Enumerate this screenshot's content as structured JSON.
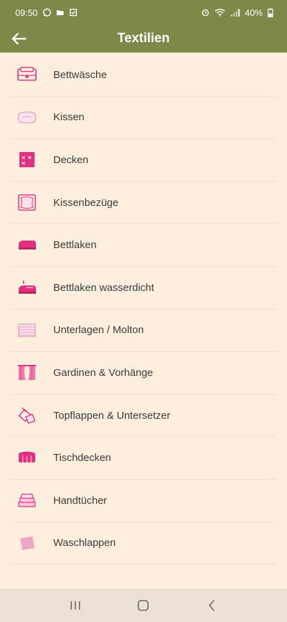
{
  "status_bar": {
    "time": "09:50",
    "battery": "40%"
  },
  "app_bar": {
    "title": "Textilien"
  },
  "items": [
    {
      "label": "Bettwäsche",
      "icon": "bed-linen-icon"
    },
    {
      "label": "Kissen",
      "icon": "pillow-icon"
    },
    {
      "label": "Decken",
      "icon": "blanket-icon"
    },
    {
      "label": "Kissenbezüge",
      "icon": "pillowcase-icon"
    },
    {
      "label": "Bettlaken",
      "icon": "bed-sheet-icon"
    },
    {
      "label": "Bettlaken wasserdicht",
      "icon": "waterproof-sheet-icon"
    },
    {
      "label": "Unterlagen / Molton",
      "icon": "underlay-icon"
    },
    {
      "label": "Gardinen & Vorhänge",
      "icon": "curtains-icon"
    },
    {
      "label": "Topflappen & Untersetzer",
      "icon": "potholder-icon"
    },
    {
      "label": "Tischdecken",
      "icon": "tablecloth-icon"
    },
    {
      "label": "Handtücher",
      "icon": "towels-icon"
    },
    {
      "label": "Waschlappen",
      "icon": "washcloth-icon"
    }
  ],
  "colors": {
    "header": "#7e8848",
    "background": "#fdeedd",
    "accent": "#e0307f"
  }
}
